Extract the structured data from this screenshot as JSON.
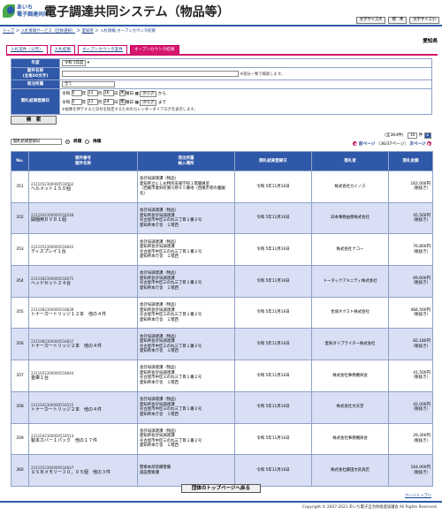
{
  "header": {
    "brand_line1": "あいち",
    "brand_line2": "電子調達共同",
    "app_title": "電子調達共同システム（物品等）",
    "buttons": [
      "文字サイズ大",
      "標　準",
      "文字サイズ小"
    ]
  },
  "breadcrumb": [
    "トップ",
    "入札情報サービス（団体選択）",
    "愛知県",
    "入札情報-オープンカウンタ結果"
  ],
  "breadcrumb_sep": " ＞ ",
  "org": "愛知県",
  "tabs": [
    "入札案件（公告）",
    "入札結果",
    "オープンカウンタ案件",
    "オープンカウンタ結果"
  ],
  "form": {
    "year_label": "年度",
    "year_value": "令和 5年度",
    "name_label": "案件名称\n(全角50文字)",
    "name_note": "※部分一致で検索します。",
    "type_label": "発注所属",
    "type_value": "全て",
    "date_label": "開札結果登録日",
    "from": {
      "era": "令和",
      "y": "5",
      "m": "11",
      "d": "16",
      "dow": "木",
      "btn": "クリア",
      "suffix": "から"
    },
    "to": {
      "era": "令和",
      "y": "5",
      "m": "11",
      "d": "24",
      "dow": "金",
      "btn": "クリア",
      "suffix": "まで"
    },
    "cal_note": "※画像を押下すると日付を指定するためのカレンダーダイアログを表示します。",
    "unit_y": "年",
    "unit_m": "月",
    "unit_d": "日",
    "unit_dow": "曜日"
  },
  "search_button": "検　索",
  "sort": {
    "select": "開札結果登録日",
    "asc": "昇順",
    "desc": "降順"
  },
  "pager": {
    "total": "（全364件）",
    "per_page": "10",
    "per_unit": "件",
    "prev": "前ページ",
    "page": "（36/37ページ）",
    "next": "次ページ"
  },
  "table": {
    "headers": [
      "No.",
      "案件番号\n案件名称",
      "発注所属\n納入場所",
      "開札結果登録日",
      "落札者",
      "落札金額"
    ],
    "rows": [
      {
        "no": "351",
        "code": "2311052300000518562",
        "name": "ヘルメット１５０個",
        "place": "会計局調達課（物品）\n愛知県立にしお特別支援学校１階職員室\n（西尾市菱鈴町東川原６５番地（西尾市巻の農園　北）",
        "date": "令和 5年11月16日",
        "winner": "株式会社カイノス",
        "amount": "162,000円\n（税抜き）"
      },
      {
        "no": "352",
        "code": "2311042300000518548",
        "name": "開梱用ＤＶＤ１個",
        "place": "会計局調達課（物品）\n愛知県会計局調達課\n名古屋市中区三の丸三丁目１番２号\n愛知県本庁舎　１階西",
        "date": "令和 5年11月16日",
        "winner": "日本事務由務株式会社",
        "amount": "45,500円\n（税抜き）"
      },
      {
        "no": "353",
        "code": "2311052300000518642",
        "name": "ディスプレイ１台",
        "place": "会計局調達課（物品）\n愛知県会計局調達課\n名古屋市中区三の丸三丁目１番２号\n愛知県本庁舎　１階西",
        "date": "令和 5年11月16日",
        "winner": "株式会社ナコー",
        "amount": "76,800円\n（税抜き）"
      },
      {
        "no": "354",
        "code": "2311082300000518075",
        "name": "ヘッドセット２４台",
        "place": "会計局調達課（物品）\n愛知県会計局調達課\n名古屋市中区三の丸三丁目１番２号\n愛知県本庁舎　１階西",
        "date": "令和 5年11月16日",
        "winner": "トータックアメニティ株式会社",
        "amount": "69,600円\n（税抜き）"
      },
      {
        "no": "355",
        "code": "2311082300000518838",
        "name": "トナーカートリッジ１２本　他の４件",
        "place": "会計局調達課（物品）\n愛知県会計局調達課\n名古屋市中区三の丸三丁目１番２号\n愛知県本庁舎　１階西",
        "date": "令和 5年11月16日",
        "winner": "金城ネクスト株式会社",
        "amount": "484,560円\n（税抜き）"
      },
      {
        "no": "356",
        "code": "2311082300000518837",
        "name": "トナーカートリッジ２本　他の４件",
        "place": "会計局調達課（物品）\n愛知県会計局調達課\n名古屋市中区三の丸三丁目１番２号\n愛知県本庁舎　１階西",
        "date": "令和 5年11月16日",
        "winner": "愛知ダイプライター株式会社",
        "amount": "82,180円\n（税抜き）"
      },
      {
        "no": "357",
        "code": "2311052300000518644",
        "name": "金庫１台",
        "place": "会計局調達課（物品）\n愛知県会計局調達課\n名古屋市中区三の丸三丁目１番２号\n愛知県本庁舎　１階西",
        "date": "令和 5年11月16日",
        "winner": "株式会社事務機商会",
        "amount": "41,500円\n（税抜き）"
      },
      {
        "no": "358",
        "code": "2311042300000518515",
        "name": "トナーカートリッジ２本　他の４件",
        "place": "会計局調達課（物品）\n愛知県会計局調達課\n名古屋市中区三の丸三丁目１番２号\n愛知県本庁舎　１階西",
        "date": "令和 5年11月16日",
        "winner": "株式会社文天堂",
        "amount": "42,000円\n（税抜き）"
      },
      {
        "no": "359",
        "code": "2311042300000518514",
        "name": "製本カバー１パック　他の１７件",
        "place": "会計局調達課（物品）\n愛知県会計局調達課\n名古屋市中区三の丸三丁目１番２号\n愛知県本庁舎　１階西",
        "date": "令和 5年11月16日",
        "winner": "株式会社事務機商会",
        "amount": "29,300円\n（税抜き）"
      },
      {
        "no": "360",
        "code": "2311052300000518647",
        "name": "ＵＳＢメモリー３０，０５個　他の３件",
        "place": "警察本部装備警備\n施設警察課",
        "date": "令和 5年11月16日",
        "winner": "株式会社藤田文房具店",
        "amount": "164,000円\n（税抜き）"
      }
    ]
  },
  "bottom_button": "団体のトップページへ戻る",
  "to_top": "ページトップへ",
  "copyright": "Copyright © 2007-2021 あいち電子自治体推進協議会 All Rights Reserved."
}
